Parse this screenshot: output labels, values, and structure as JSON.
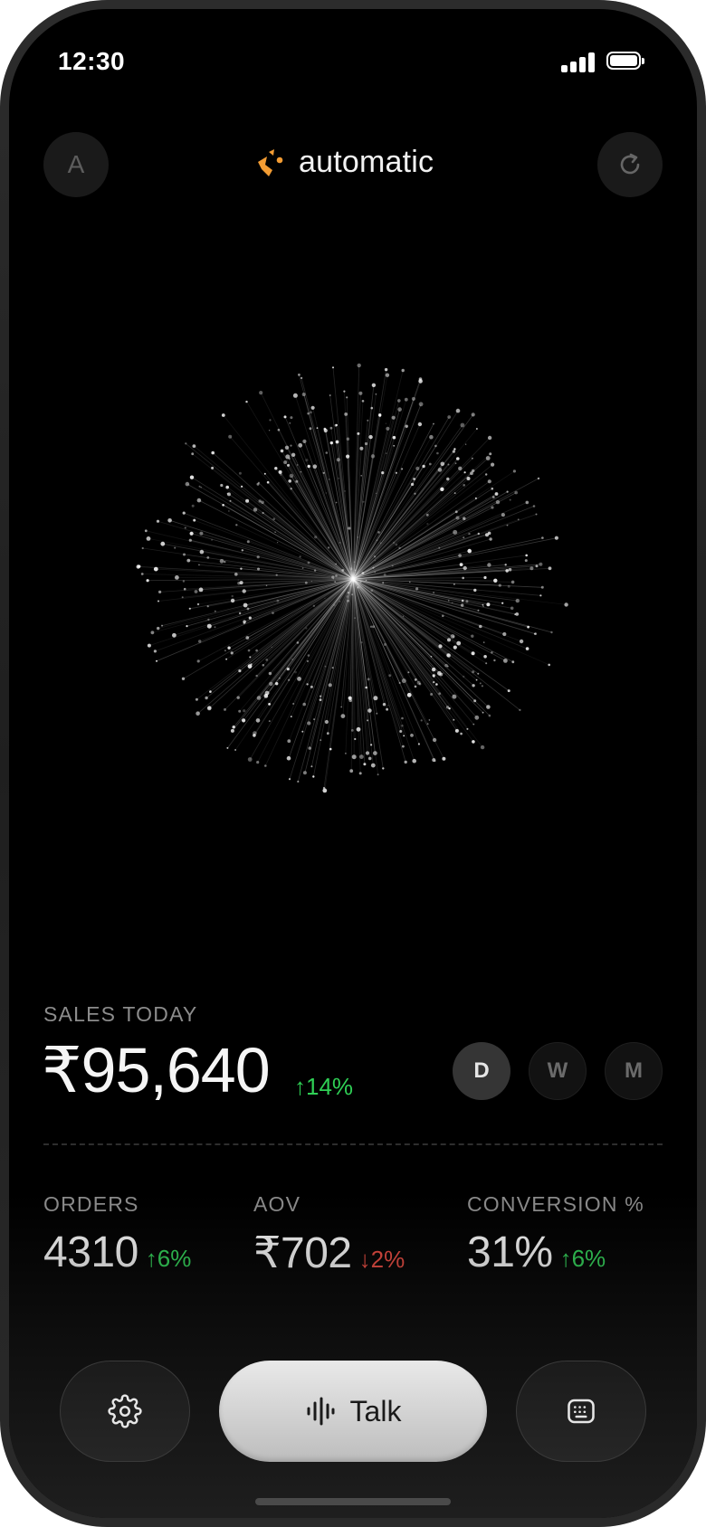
{
  "status_bar": {
    "time": "12:30"
  },
  "header": {
    "avatar_initial": "A",
    "brand_name": "automatic",
    "brand_color": "#f39c33"
  },
  "sales": {
    "label": "SALES TODAY",
    "value": "₹95,640",
    "change": "↑14%",
    "periods": [
      "D",
      "W",
      "M"
    ],
    "active_period": "D"
  },
  "metrics": [
    {
      "label": "ORDERS",
      "value": "4310",
      "change": "↑6%",
      "direction": "up"
    },
    {
      "label": "AOV",
      "value": "₹702",
      "change": "↓2%",
      "direction": "down"
    },
    {
      "label": "CONVERSION %",
      "value": "31%",
      "change": "↑6%",
      "direction": "up"
    }
  ],
  "bottom_bar": {
    "left_icon": "gear-icon",
    "talk_label": "Talk",
    "talk_icon": "waveform-icon",
    "right_icon": "keyboard-icon"
  },
  "colors": {
    "positive": "#2fcf55",
    "negative": "#e5483e",
    "background": "#000000"
  }
}
